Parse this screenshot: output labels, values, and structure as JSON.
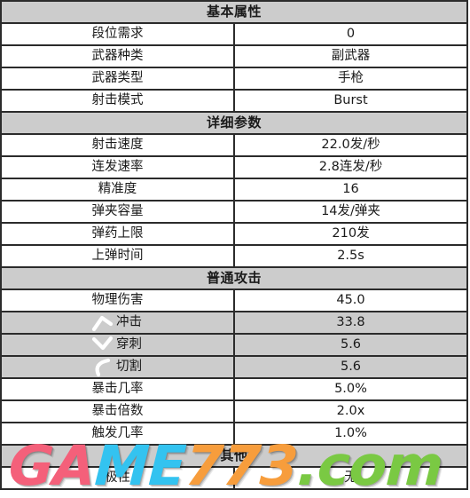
{
  "sections": [
    {
      "id": "basic",
      "header": "基本属性",
      "rows": [
        {
          "label": "段位需求",
          "value": "0",
          "gray": false,
          "icon": null
        },
        {
          "label": "武器种类",
          "value": "副武器",
          "gray": false,
          "icon": null
        },
        {
          "label": "武器类型",
          "value": "手枪",
          "gray": false,
          "icon": null
        },
        {
          "label": "射击模式",
          "value": "Burst",
          "gray": false,
          "icon": null
        }
      ]
    },
    {
      "id": "detail",
      "header": "详细参数",
      "rows": [
        {
          "label": "射击速度",
          "value": "22.0发/秒",
          "gray": false,
          "icon": null
        },
        {
          "label": "连发速率",
          "value": "2.8连发/秒",
          "gray": false,
          "icon": null
        },
        {
          "label": "精准度",
          "value": "16",
          "gray": false,
          "icon": null
        },
        {
          "label": "弹夹容量",
          "value": "14发/弹夹",
          "gray": false,
          "icon": null
        },
        {
          "label": "弹药上限",
          "value": "210发",
          "gray": false,
          "icon": null
        },
        {
          "label": "上弹时间",
          "value": "2.5s",
          "gray": false,
          "icon": null
        }
      ]
    },
    {
      "id": "normal-attack",
      "header": "普通攻击",
      "rows": [
        {
          "label": "物理伤害",
          "value": "45.0",
          "gray": false,
          "icon": null
        },
        {
          "label": "冲击",
          "value": "33.8",
          "gray": true,
          "icon": "impact-icon"
        },
        {
          "label": "穿刺",
          "value": "5.6",
          "gray": true,
          "icon": "puncture-icon"
        },
        {
          "label": "切割",
          "value": "5.6",
          "gray": true,
          "icon": "slash-icon"
        },
        {
          "label": "暴击几率",
          "value": "5.0%",
          "gray": false,
          "icon": null
        },
        {
          "label": "暴击倍数",
          "value": "2.0x",
          "gray": false,
          "icon": null
        },
        {
          "label": "触发几率",
          "value": "1.0%",
          "gray": false,
          "icon": null
        }
      ]
    },
    {
      "id": "other",
      "header": "其他",
      "rows": [
        {
          "label": "极性",
          "value": "无",
          "gray": false,
          "icon": null
        }
      ]
    }
  ],
  "watermark": {
    "part1": "G",
    "part2": "A",
    "part3": "M",
    "part4": "E",
    "part5": "7",
    "part6": "73",
    "part7": ".",
    "part8": "com",
    "colors": {
      "pink": "#f4607a",
      "cyan": "#33c3f0",
      "orange": "#f79d3c",
      "green": "#7ac943"
    }
  },
  "theme": {
    "header_bg": "#cccccc",
    "row_bg": "#ffffff",
    "border": "#2b2b2b",
    "text": "#1a1a1a"
  }
}
